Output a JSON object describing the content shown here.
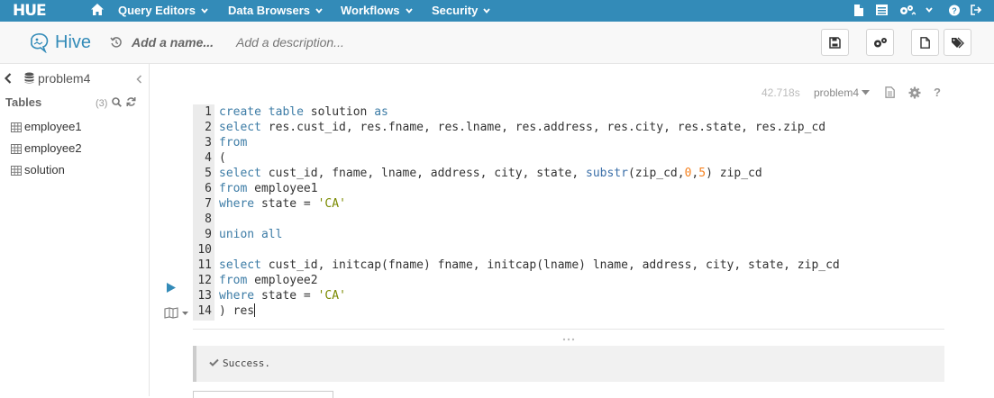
{
  "nav": {
    "logo": "HUE",
    "menus": [
      "Query Editors",
      "Data Browsers",
      "Workflows",
      "Security"
    ]
  },
  "header": {
    "title": "Hive",
    "name_placeholder": "Add a name...",
    "description_placeholder": "Add a description..."
  },
  "sidebar": {
    "database": "problem4",
    "tables_heading": "Tables",
    "table_count": "(3)",
    "tables": [
      "employee1",
      "employee2",
      "solution"
    ]
  },
  "snippet": {
    "execution_time": "42.718s",
    "database": "problem4"
  },
  "editor": {
    "lines": [
      {
        "n": "1",
        "t": "create table solution as"
      },
      {
        "n": "2",
        "t": "select res.cust_id, res.fname, res.lname, res.address, res.city, res.state, res.zip_cd"
      },
      {
        "n": "3",
        "t": "from"
      },
      {
        "n": "4",
        "t": "("
      },
      {
        "n": "5",
        "t": "select cust_id, fname, lname, address, city, state, substr(zip_cd,0,5) zip_cd"
      },
      {
        "n": "6",
        "t": "from employee1"
      },
      {
        "n": "7",
        "t": "where state = 'CA'"
      },
      {
        "n": "8",
        "t": ""
      },
      {
        "n": "9",
        "t": "union all"
      },
      {
        "n": "10",
        "t": ""
      },
      {
        "n": "11",
        "t": "select cust_id, initcap(fname) fname, initcap(lname) lname, address, city, state, zip_cd"
      },
      {
        "n": "12",
        "t": "from employee2"
      },
      {
        "n": "13",
        "t": "where state = 'CA'"
      },
      {
        "n": "14",
        "t": ") res"
      }
    ]
  },
  "result": {
    "message": "Success."
  }
}
